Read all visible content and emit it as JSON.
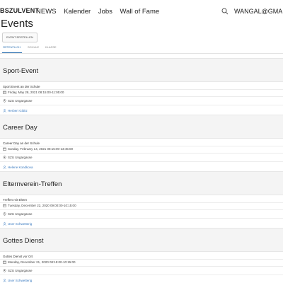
{
  "header": {
    "brand": "BSZULVENT",
    "nav": [
      "NEWS",
      "Kalender",
      "Jobs",
      "Wall of Fame"
    ],
    "user": "WANGAL@GMAIL.C"
  },
  "page": {
    "title": "Events",
    "new_event_label": "EVENT ERSTELLEN",
    "tabs": [
      "ÖFFENTLICH",
      "SCHULE",
      "KLASSE"
    ]
  },
  "events": [
    {
      "title": "Sport-Event",
      "description": "Sport Event an der Schule",
      "datetime": "Friday, May 28, 2021 08:15:00-11:05:00",
      "location": "SZU Ungargasse",
      "organizer": "Herbert Gibitz"
    },
    {
      "title": "Career Day",
      "description": "Career Day an der Schule",
      "datetime": "Sunday, February 14, 2021 08:15:00-13:45:00",
      "location": "SZU Ungargasse",
      "organizer": "Helene Kondkova"
    },
    {
      "title": "Elternverein-Treffen",
      "description": "Treffen mit Eltern",
      "datetime": "Tuesday, December 22, 2020 09:00:00-10:15:00",
      "location": "SZU Ungargasse",
      "organizer": "User Schwetterig"
    },
    {
      "title": "Gottes Dienst",
      "description": "Gottes Dienst vor Ort",
      "datetime": "Monday, December 21, 2020 08:15:00-10:15:00",
      "location": "SZU Ungargasse",
      "organizer": "User Schwetterig"
    }
  ]
}
